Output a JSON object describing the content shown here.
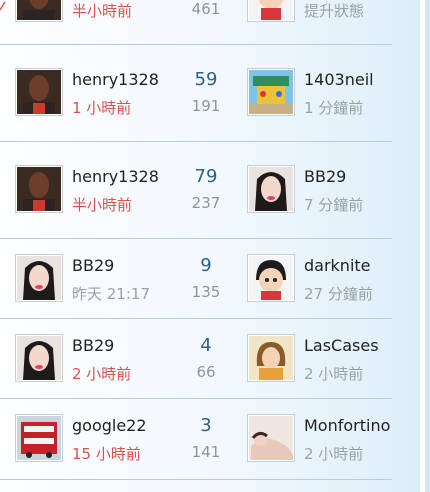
{
  "rows": [
    {
      "left_name": "",
      "left_time": "半小時前",
      "replies": "",
      "views": "461",
      "right_name": "",
      "right_time": "提升狀態"
    },
    {
      "left_name": "henry1328",
      "left_time": "1 小時前",
      "replies": "59",
      "views": "191",
      "right_name": "1403neil",
      "right_time": "1 分鐘前"
    },
    {
      "left_name": "henry1328",
      "left_time": "半小時前",
      "replies": "79",
      "views": "237",
      "right_name": "BB29",
      "right_time": "7 分鐘前"
    },
    {
      "left_name": "BB29",
      "left_time": "昨天 21:17",
      "replies": "9",
      "views": "135",
      "right_name": "darknite",
      "right_time": "27 分鐘前"
    },
    {
      "left_name": "BB29",
      "left_time": "2 小時前",
      "replies": "4",
      "views": "66",
      "right_name": "LasCases",
      "right_time": "2 小時前"
    },
    {
      "left_name": "google22",
      "left_time": "15 小時前",
      "replies": "3",
      "views": "141",
      "right_name": "Monfortino",
      "right_time": "2 小時前"
    }
  ],
  "colors": {
    "recent_time": "#d9534f",
    "old_time": "#9aa2a8",
    "reply_count": "#2f5f86",
    "separator": "#b9cbd9"
  },
  "icons": {
    "man_portrait": "man-avatar-icon",
    "woman_portrait": "woman-avatar-icon",
    "cartoon": "cartoon-avatar-icon",
    "bus": "bus-avatar-icon",
    "playground": "playground-avatar-icon"
  }
}
